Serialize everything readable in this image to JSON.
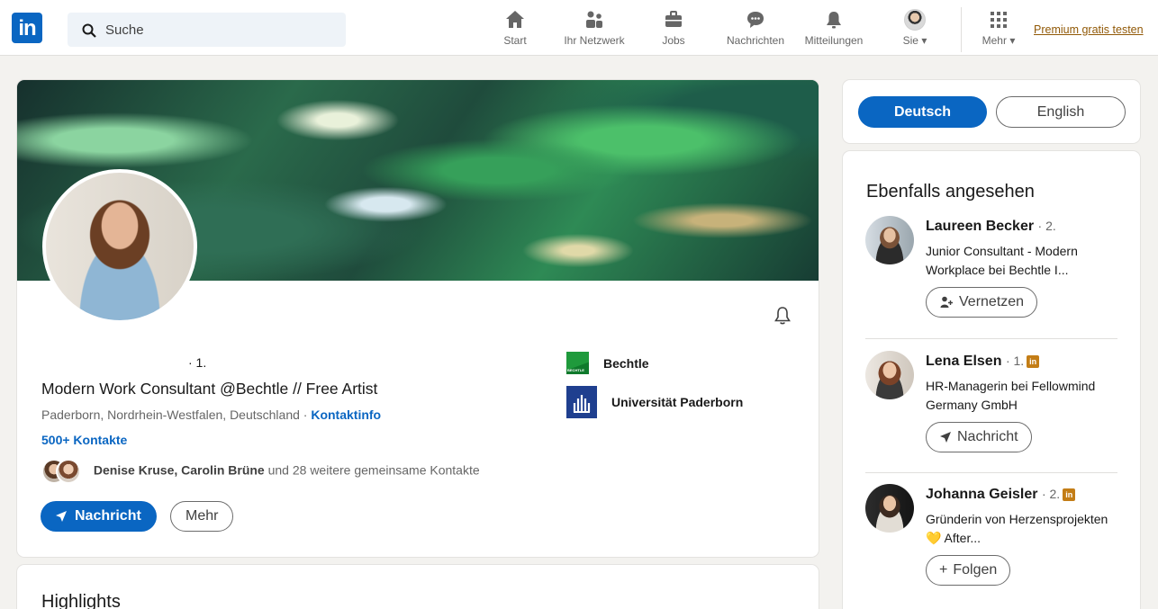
{
  "nav": {
    "logo": "in",
    "search_placeholder": "Suche",
    "items": [
      {
        "label": "Start",
        "icon": "home-icon"
      },
      {
        "label": "Ihr Netzwerk",
        "icon": "network-icon"
      },
      {
        "label": "Jobs",
        "icon": "briefcase-icon"
      },
      {
        "label": "Nachrichten",
        "icon": "messaging-icon"
      },
      {
        "label": "Mitteilungen",
        "icon": "bell-icon"
      },
      {
        "label": "Sie",
        "icon": "avatar"
      },
      {
        "label": "Mehr",
        "icon": "grid-icon"
      }
    ],
    "premium": "Premium gratis testen"
  },
  "profile": {
    "degree": "· 1.",
    "headline": "Modern Work Consultant @Bechtle // Free Artist",
    "location": "Paderborn, Nordrhein-Westfalen, Deutschland ·",
    "contact_info": "Kontaktinfo",
    "connections": "500+ Kontakte",
    "mutual_names": "Denise Kruse, Carolin Brüne",
    "mutual_rest": "und 28 weitere gemeinsame Kontakte",
    "message_button": "Nachricht",
    "more_button": "Mehr",
    "orgs": [
      "Bechtle",
      "Universität Paderborn"
    ]
  },
  "highlights": {
    "title": "Highlights"
  },
  "language": {
    "deutsch": "Deutsch",
    "english": "English"
  },
  "also_viewed": {
    "title": "Ebenfalls angesehen",
    "people": [
      {
        "name": "Laureen Becker",
        "degree": "· 2.",
        "subtitle": "Junior Consultant - Modern Workplace bei Bechtle I...",
        "button": "Vernetzen"
      },
      {
        "name": "Lena Elsen",
        "degree": "· 1.",
        "subtitle": "HR-Managerin bei Fellowmind Germany GmbH",
        "button": "Nachricht"
      },
      {
        "name": "Johanna Geisler",
        "degree": "· 2.",
        "subtitle": "Gründerin von Herzensprojekten 💛 After...",
        "button": "Folgen"
      }
    ]
  },
  "colors": {
    "accent": "#0a66c2",
    "premium": "#915907",
    "premium_badge": "#c37d16"
  }
}
